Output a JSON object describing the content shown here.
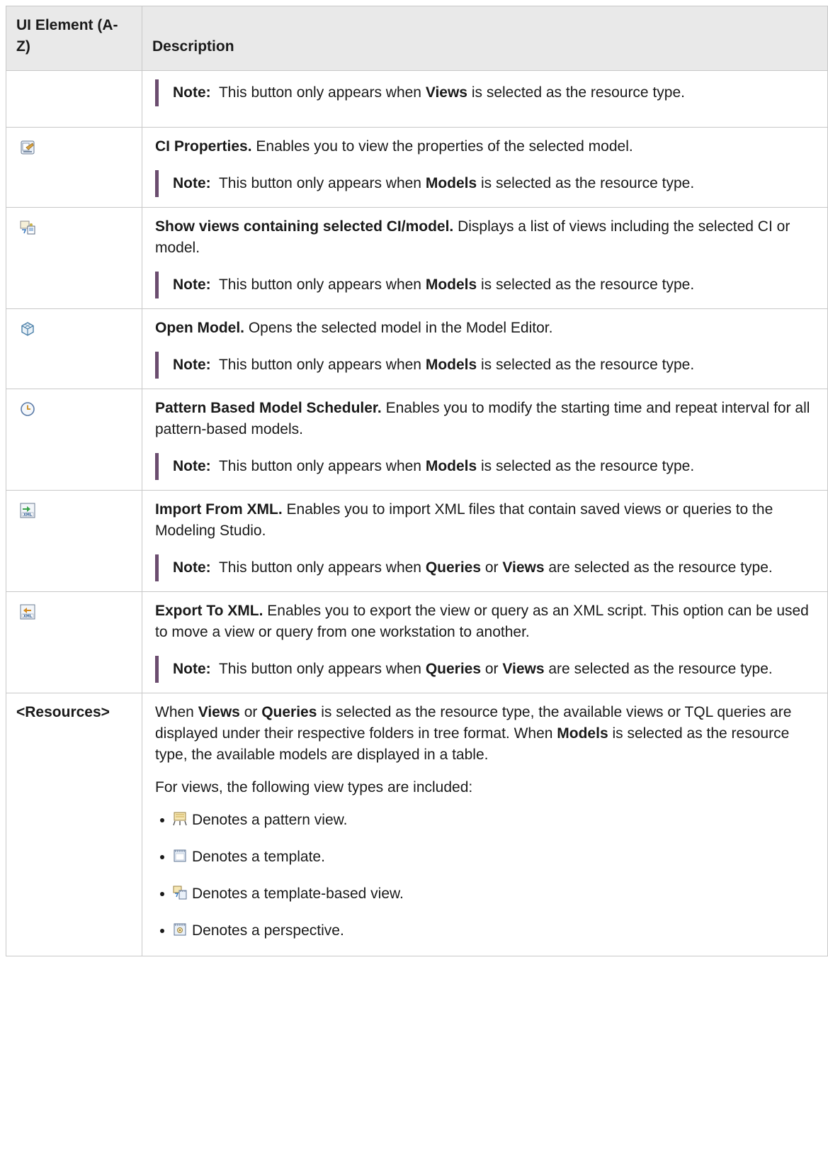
{
  "header": {
    "col1": "UI Element (A-Z)",
    "col2": "Description"
  },
  "rows": {
    "r0": {
      "note_label": "Note:",
      "note_pre": "This button only appears when ",
      "note_bold": "Views",
      "note_post": " is selected as the resource type."
    },
    "r1": {
      "icon": "ci-properties-icon",
      "title": "CI Properties.",
      "text": " Enables you to view the properties of the selected model.",
      "note_label": "Note:",
      "note_pre": "This button only appears when ",
      "note_bold": "Models",
      "note_post": " is selected as the resource type."
    },
    "r2": {
      "icon": "show-views-icon",
      "title": "Show views containing selected CI/model.",
      "text": " Displays a list of views including the selected CI or model.",
      "note_label": "Note:",
      "note_pre": "This button only appears when ",
      "note_bold": "Models",
      "note_post": " is selected as the resource type."
    },
    "r3": {
      "icon": "open-model-icon",
      "title": "Open Model.",
      "text": " Opens the selected model in the Model Editor.",
      "note_label": "Note:",
      "note_pre": "This button only appears when ",
      "note_bold": "Models",
      "note_post": " is selected as the resource type."
    },
    "r4": {
      "icon": "scheduler-clock-icon",
      "title": "Pattern Based Model Scheduler.",
      "text": " Enables you to modify the starting time and repeat interval for all pattern-based models.",
      "note_label": "Note:",
      "note_pre": "This button only appears when ",
      "note_bold": "Models",
      "note_post": " is selected as the resource type."
    },
    "r5": {
      "icon": "import-xml-icon",
      "title": "Import From XML.",
      "text": " Enables you to import XML files that contain saved views or queries to the Modeling Studio.",
      "note_label": "Note:",
      "note_pre": "This button only appears when ",
      "note_bold": "Queries",
      "note_mid": " or ",
      "note_bold2": "Views",
      "note_post": " are selected as the resource type."
    },
    "r6": {
      "icon": "export-xml-icon",
      "title": "Export To XML.",
      "text": " Enables you to export the view or query as an XML script. This option can be used to move a view or query from one workstation to another.",
      "note_label": "Note:",
      "note_pre": "This button only appears when ",
      "note_bold": "Queries",
      "note_mid": " or ",
      "note_bold2": "Views",
      "note_post": " are selected as the resource type."
    },
    "r7": {
      "name": "<Resources>",
      "p1_a": "When ",
      "p1_b": "Views",
      "p1_c": " or ",
      "p1_d": "Queries",
      "p1_e": " is selected as the resource type, the available views or TQL queries are displayed under their respective folders in tree format. When ",
      "p1_f": "Models",
      "p1_g": " is selected as the resource type, the available models are displayed in a table.",
      "p2": "For views, the following view types are included:",
      "bullets": [
        {
          "icon": "pattern-view-icon",
          "text": "Denotes a pattern view."
        },
        {
          "icon": "template-icon",
          "text": "Denotes a template."
        },
        {
          "icon": "template-based-view-icon",
          "text": "Denotes a template-based view."
        },
        {
          "icon": "perspective-icon",
          "text": "Denotes a perspective."
        }
      ]
    }
  }
}
